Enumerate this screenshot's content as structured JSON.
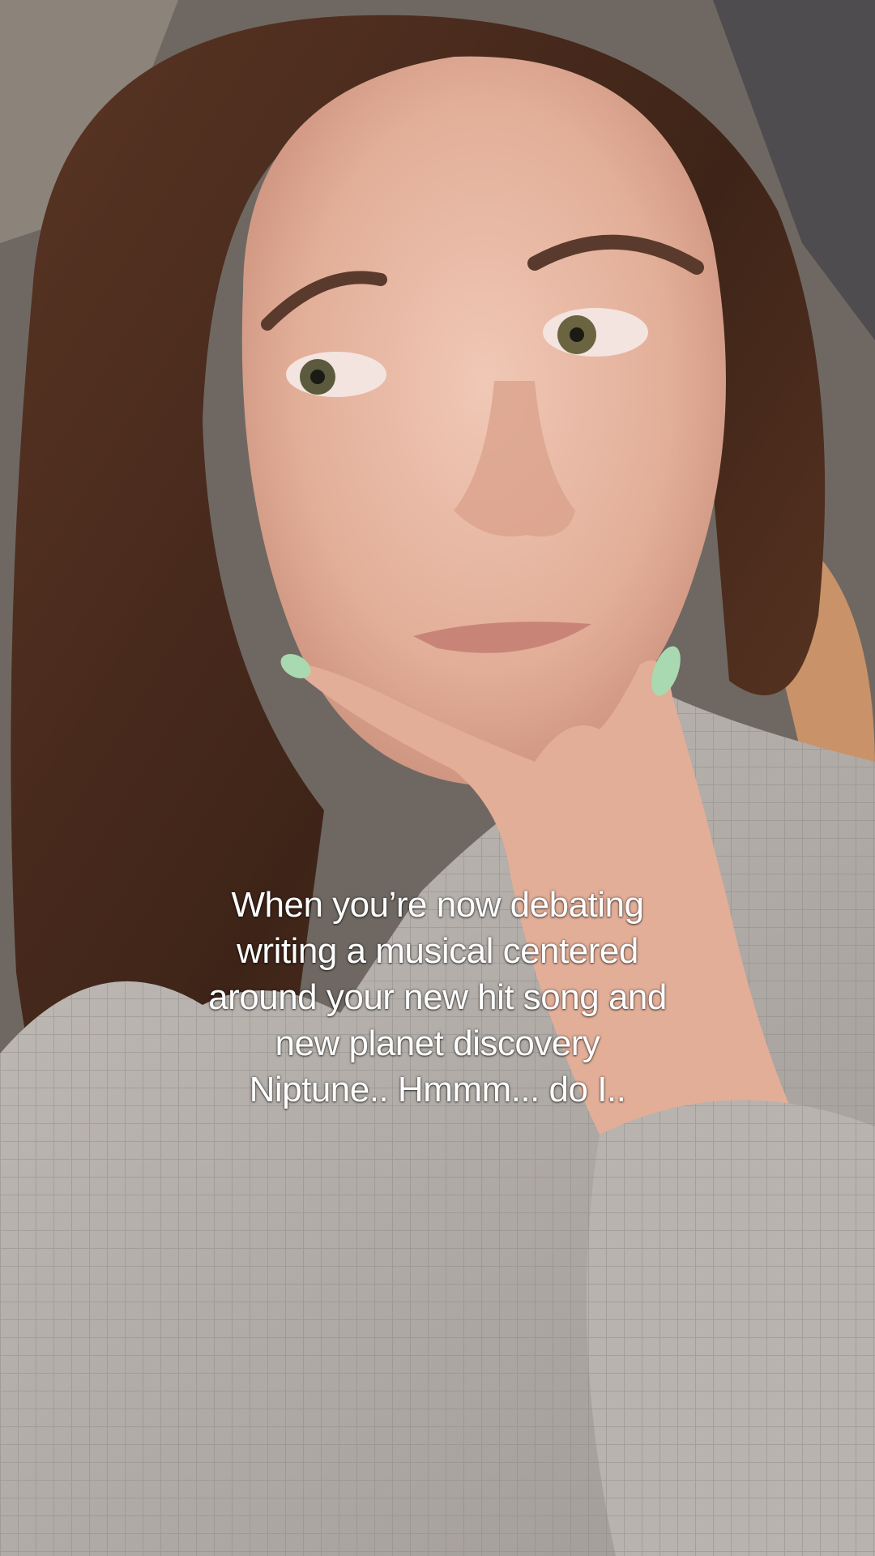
{
  "video": {
    "description": "woman-thinking-hand-on-chin-selfie",
    "caption_lines": [
      "When you’re now debating",
      "writing a musical centered",
      "around your new hit song and",
      "new planet discovery",
      "Niptune.. Hmmm... do I.."
    ]
  },
  "colors": {
    "caption_text": "#ffffff",
    "hair": "#4a2c1e",
    "skin": "#e6b6a2",
    "robe": "#b5b0ab",
    "nails": "#a9d9b0",
    "background_wall": "#7a7470"
  }
}
